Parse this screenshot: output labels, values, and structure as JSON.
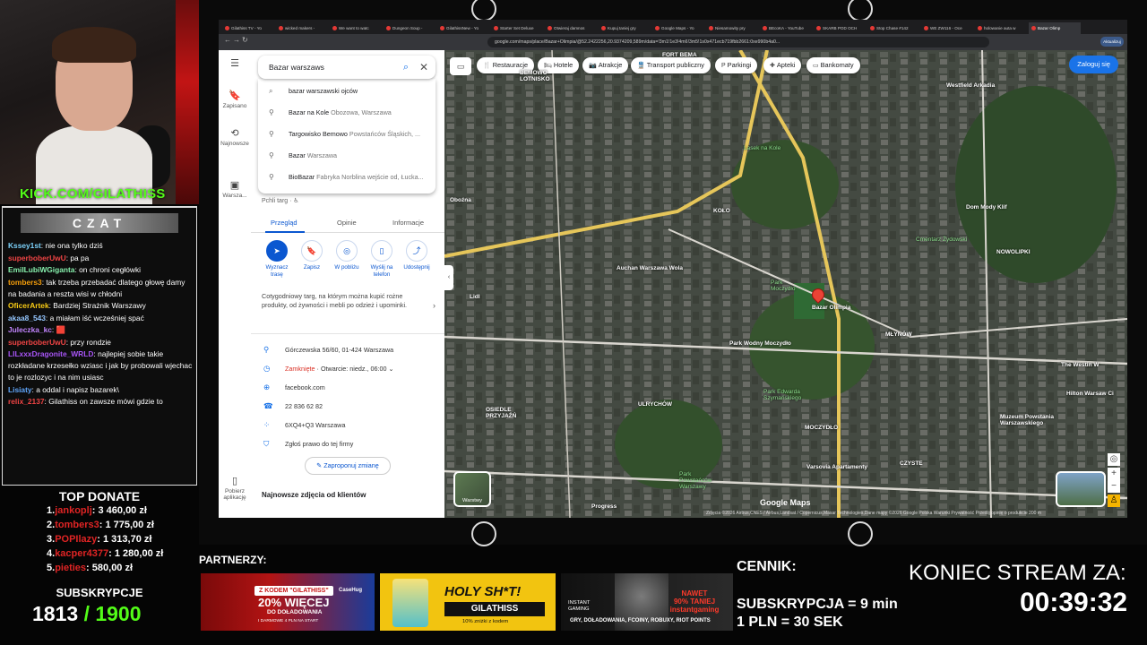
{
  "webcam": {
    "overlay_text": "KICK.COM/GILATHISS"
  },
  "chat": {
    "title": "CZAT",
    "messages": [
      {
        "user": "Kssey1st",
        "text": "nie ona tylko dziś",
        "color": "#7dd3fc"
      },
      {
        "user": "superboberUwU",
        "text": "pa pa",
        "color": "#ef4444"
      },
      {
        "user": "EmilLubiWGiganta",
        "text": "on chroni cegłówki",
        "color": "#86efac"
      },
      {
        "user": "tombers3",
        "text": "tak trzeba przebadać dlatego głowę damy na badania a reszta wisi w chłodni",
        "color": "#f59e0b"
      },
      {
        "user": "OficerArtek",
        "text": "Bardziej Strażnik Warszawy",
        "color": "#facc15"
      },
      {
        "user": "akaa8_543",
        "text": "a miałam iść wcześniej spać",
        "color": "#93c5fd"
      },
      {
        "user": "Juleczka_kc",
        "text": "🟥",
        "color": "#c084fc"
      },
      {
        "user": "superboberUwU",
        "text": "przy rondzie",
        "color": "#ef4444"
      },
      {
        "user": "LILxxxDragonite_WRLD",
        "text": "najlepiej sobie takie rozkładane krzesełko wziasc i jak by probowali wjechac to je rozlozyc i na nim usiasc",
        "color": "#a855f7"
      },
      {
        "user": "Lisiaty",
        "text": "a oddal i napisz bazarek\\",
        "color": "#60a5fa"
      },
      {
        "user": "relix_2137",
        "text": "Gilathiss on zawsze mówi gdzie to",
        "color": "#ef4444"
      }
    ]
  },
  "top_donate": {
    "title": "TOP DONATE",
    "rows": [
      {
        "rank": "1.",
        "name": "jankoplj",
        "amount": "3 460,00 zł"
      },
      {
        "rank": "2.",
        "name": "tombers3",
        "amount": "1 775,00 zł"
      },
      {
        "rank": "3.",
        "name": "POPIlazy",
        "amount": "1 313,70 zł"
      },
      {
        "rank": "4.",
        "name": "kacper4377",
        "amount": "1 280,00 zł"
      },
      {
        "rank": "5.",
        "name": "pieties",
        "amount": "580,00 zł"
      }
    ]
  },
  "subscriptions": {
    "title": "SUBSKRYPCJE",
    "current": "1813",
    "goal": "/ 1900"
  },
  "browser": {
    "tabs": [
      "Gilathiss TV - Yo",
      "wicked makers -",
      "We want to watc",
      "Dungeon Soup -",
      "GilathissNew - Yo",
      "Starter Set Deluxe",
      "Otwieraj damnos",
      "Kupuj taniej gry",
      "Google Maps - Yo",
      "Niesamowity pry",
      "BEcoKA - YouTube",
      "SKARB POD OCH",
      "Stop Chase #142",
      "WE ZW116 - Oce",
      "holowanie auta w",
      "Bazar Olimp"
    ],
    "url": "google.com/maps/place/Bazar+Olimpia/@52.2422256,20.9374209,589m/data=!3m1!1e3!4m6!3m5!1s0x471ecb719fbb2661:0xe990b4a0...",
    "update_label": "Aktualizuj"
  },
  "maps": {
    "rail": [
      {
        "label": "",
        "icon": "menu-icon"
      },
      {
        "label": "Zapisano",
        "icon": "bookmark-icon"
      },
      {
        "label": "Najnowsze",
        "icon": "history-icon"
      },
      {
        "label": "Warsza...",
        "icon": "thumbnail-icon"
      },
      {
        "label": "Pobierz aplikację",
        "icon": "phone-icon"
      }
    ],
    "search": {
      "value": "Bazar warszaws",
      "suggestions": [
        {
          "main": "bazar warszawski ojców",
          "sub": "",
          "icon": "search-icon"
        },
        {
          "main": "Bazar na Kole",
          "sub": " Obozowa, Warszawa",
          "icon": "pin-icon"
        },
        {
          "main": "Targowisko Bemowo",
          "sub": " Powstańców Śląskich, ...",
          "icon": "pin-icon"
        },
        {
          "main": "Bazar",
          "sub": " Warszawa",
          "icon": "pin-icon"
        },
        {
          "main": "BioBazar",
          "sub": " Fabryka Norblina wejście od, Łucka...",
          "icon": "pin-icon"
        }
      ]
    },
    "place_subtitle": "Pchli targ · ♿",
    "tabs": [
      "Przegląd",
      "Opinie",
      "Informacje"
    ],
    "actions": [
      "Wyznacz trasę",
      "Zapisz",
      "W pobliżu",
      "Wyślij na telefon",
      "Udostępnij"
    ],
    "description": "Cotygodniowy targ, na którym można kupić rożne produkty, od żywności i mebli po odzież i upominki.",
    "info": [
      {
        "icon": "location-icon",
        "text": "Górczewska 56/60, 01-424 Warszawa"
      },
      {
        "icon": "clock-icon",
        "status": "Zamknięte",
        "text": " · Otwarcie: niedz., 06:00 ⌄"
      },
      {
        "icon": "globe-icon",
        "text": "facebook.com"
      },
      {
        "icon": "phone-icon",
        "text": "22 836 62 82"
      },
      {
        "icon": "pluscode-icon",
        "text": "6XQ4+Q3 Warszawa"
      },
      {
        "icon": "shield-icon",
        "text": "Zgłoś prawo do tej firmy"
      }
    ],
    "suggest_edit": "✎ Zaproponuj zmianę",
    "latest_photos": "Najnowsze zdjęcia od klientów",
    "chips": [
      "Restauracje",
      "Hotele",
      "Atrakcje",
      "Transport publiczny",
      "Parkingi",
      "Apteki",
      "Bankomaty"
    ],
    "login": "Zaloguj się",
    "labels": [
      {
        "text": "FORT BEMA",
        "style": ""
      },
      {
        "text": "BEMOWO\nLOTNISKO",
        "style": ""
      },
      {
        "text": "KOŁO",
        "style": ""
      },
      {
        "text": "Lasek na Kole",
        "style": "green"
      },
      {
        "text": "Cmentarz Żydowski",
        "style": "green"
      },
      {
        "text": "NOWOLIPKI",
        "style": ""
      },
      {
        "text": "MŁYNÓW",
        "style": ""
      },
      {
        "text": "ULRYCHÓW",
        "style": ""
      },
      {
        "text": "OSIEDLE\nPRZYJAŹŃ",
        "style": ""
      },
      {
        "text": "MOCZYDŁO",
        "style": ""
      },
      {
        "text": "CZYSTE",
        "style": ""
      },
      {
        "text": "Park\nMoczydło",
        "style": "green"
      },
      {
        "text": "Park Wodny Moczydło",
        "style": ""
      },
      {
        "text": "Park Edwarda\nSzymańskiego",
        "style": "green"
      },
      {
        "text": "Park\nPowstańców\nWarszawy",
        "style": "green"
      },
      {
        "text": "Westfield Arkadia",
        "style": ""
      },
      {
        "text": "Dom Mody Klif",
        "style": ""
      },
      {
        "text": "Auchan Warszawa Wola",
        "style": ""
      },
      {
        "text": "Bazar Olimpia",
        "style": ""
      },
      {
        "text": "Muzeum Powstania\nWarszawskiego",
        "style": ""
      },
      {
        "text": "Hilton Warsaw Ci",
        "style": ""
      },
      {
        "text": "The Westin W",
        "style": ""
      },
      {
        "text": "Varsovia Apartamenty",
        "style": ""
      },
      {
        "text": "Lidl",
        "style": ""
      },
      {
        "text": "Progress",
        "style": ""
      },
      {
        "text": "Oboźna",
        "style": ""
      }
    ],
    "layers_label": "Warstwy",
    "google_logo": "Google Maps",
    "footer": "Zdjęcia ©2026 Airbus,CNES / Airbus,Landsat / Copernicus,Maxar Technologies,Dane mapy ©2026 Google   Polska   Warunki   Prywatność   Prześlij opinię o produkcie   200 m"
  },
  "partners": {
    "title": "PARTNERZY:",
    "banner1": {
      "code": "Z KODEM \"GILATHISS\"",
      "percent": "20% WIĘCEJ",
      "sub": "DO DOŁADOWANIA",
      "small": "I DARMOWE 4 PLN NA START",
      "logo": "CaseHug"
    },
    "banner2": {
      "title": "HOLY SH*T!",
      "code": "GILATHISS",
      "small": "10% zniżki z kodem"
    },
    "banner3": {
      "logo": "INSTANT\nGAMING",
      "promo": "NAWET\n90% TANIEJ\ninstantgaming",
      "small": "GRY, DOŁADOWANIA, FCOINY, ROBUXY, RIOT POINTS"
    }
  },
  "pricing": {
    "title": "CENNIK:",
    "rows": [
      "SUBSKRYPCJA = 9 min",
      "1 PLN = 30 SEK"
    ]
  },
  "countdown": {
    "title": "KONIEC STREAM ZA:",
    "time": "00:39:32"
  }
}
